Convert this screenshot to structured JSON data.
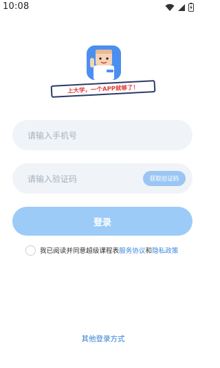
{
  "status_bar": {
    "time": "10:08",
    "icons": [
      "wifi-icon",
      "cell-signal-icon",
      "battery-charging-icon"
    ]
  },
  "logo": {
    "banner_text": "上大学，一个APP就够了！",
    "mascot_label": "课程表",
    "colors": {
      "icon_bg": "#4a8ff0",
      "banner_text": "#e0403a",
      "banner_border": "#2b3a67"
    }
  },
  "form": {
    "phone_placeholder": "请输入手机号",
    "code_placeholder": "请输入验证码",
    "get_code_label": "获取验证码",
    "login_label": "登录"
  },
  "agreement": {
    "prefix": "我已阅读并同意超级课程表",
    "service_link": "服务协议",
    "joiner": "和",
    "privacy_link": "隐私政策"
  },
  "other_login": "其他登录方式",
  "colors": {
    "primary_light": "#9ccbf7",
    "link": "#3b89d9",
    "input_bg": "#f0f4f8"
  }
}
